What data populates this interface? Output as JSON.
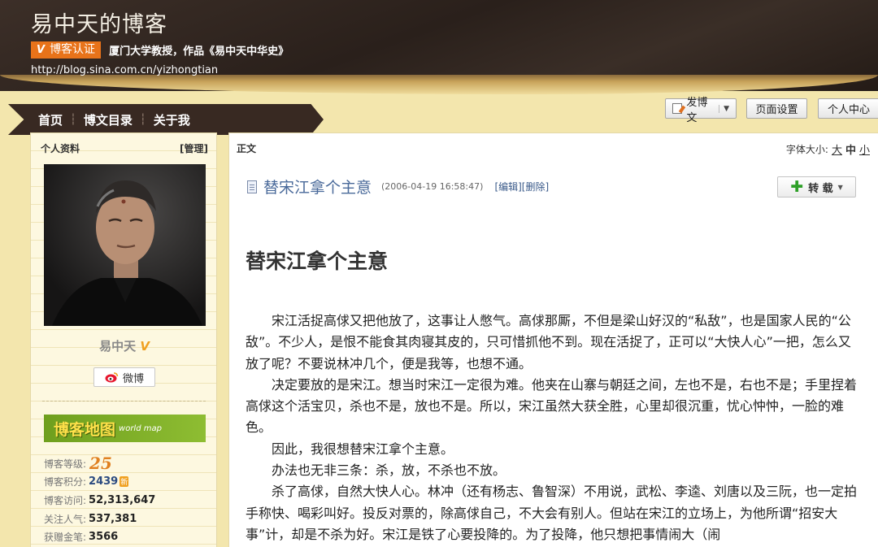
{
  "header": {
    "blog_title": "易中天的博客",
    "cert_label": "博客认证",
    "cert_v": "V",
    "cert_desc": "厦门大学教授，作品《易中天中华史》",
    "url": "http://blog.sina.com.cn/yizhongtian"
  },
  "nav": {
    "items": [
      "首页",
      "博文目录",
      "关于我"
    ]
  },
  "toolbar": {
    "post_label": "发博文",
    "settings_label": "页面设置",
    "center_label": "个人中心"
  },
  "sidebar": {
    "title": "个人资料",
    "manage": "[管理]",
    "name": "易中天",
    "weibo_label": "微博",
    "map_label": "博客地图",
    "map_sub": "world map",
    "stats": {
      "level_label": "博客等级:",
      "level_value": "25",
      "points_label": "博客积分:",
      "points_value": "2439",
      "points_badge": "新",
      "visits_label": "博客访问:",
      "visits_value": "52,313,647",
      "followers_label": "关注人气:",
      "followers_value": "537,381",
      "gold_label": "获赠金笔:",
      "gold_value": "3566"
    }
  },
  "main": {
    "section_label": "正文",
    "font_size_label": "字体大小:",
    "font_sizes": [
      "大",
      "中",
      "小"
    ],
    "article_title": "替宋江拿个主意",
    "article_date": "(2006-04-19 16:58:47)",
    "article_actions": "[编辑][删除]",
    "repost_label": "转 载",
    "heading": "替宋江拿个主意",
    "paragraphs": [
      "宋江活捉高俅又把他放了，这事让人憋气。高俅那厮，不但是梁山好汉的“私敌”，也是国家人民的“公敌”。不少人，是恨不能食其肉寝其皮的，只可惜抓他不到。现在活捉了，正可以“大快人心”一把，怎么又放了呢？不要说林冲几个，便是我等，也想不通。",
      "决定要放的是宋江。想当时宋江一定很为难。他夹在山寨与朝廷之间，左也不是，右也不是；手里捏着高俅这个活宝贝，杀也不是，放也不是。所以，宋江虽然大获全胜，心里却很沉重，忧心忡忡，一脸的难色。",
      "因此，我很想替宋江拿个主意。",
      "办法也无非三条：杀，放，不杀也不放。",
      "杀了高俅，自然大快人心。林冲（还有杨志、鲁智深）不用说，武松、李逵、刘唐以及三阮，也一定拍手称快、喝彩叫好。投反对票的，除高俅自己，不大会有别人。但站在宋江的立场上，为他所谓“招安大事”计，却是不杀为好。宋江是铁了心要投降的。为了投降，他只想把事情闹大（闹"
    ]
  },
  "colors": {
    "header_bg": "#2a201b",
    "accent": "#e8731a",
    "sidebar_bg": "#fdf8e0",
    "title_blue": "#4a6a9a"
  }
}
